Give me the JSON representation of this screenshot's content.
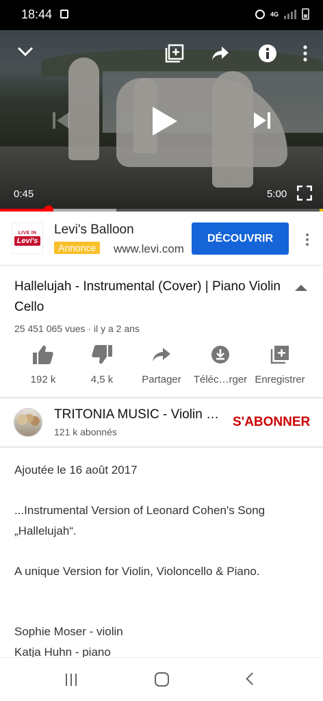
{
  "status_bar": {
    "time": "18:44",
    "network": "4G"
  },
  "player": {
    "current_time": "0:45",
    "duration": "5:00",
    "progress_fraction": 0.15,
    "buffered_fraction": 0.36
  },
  "ad": {
    "logo_line1": "LIVE IN",
    "logo_line2": "Levi's",
    "title": "Levi's Balloon",
    "badge": "Annonce",
    "url": "www.levi.com",
    "cta": "DÉCOUVRIR"
  },
  "video": {
    "title": "Hallelujah - Instrumental (Cover) | Piano Violin Cello",
    "meta": "25 451 065 vues · il y a 2 ans"
  },
  "actions": {
    "like": "192 k",
    "dislike": "4,5 k",
    "share": "Partager",
    "download": "Téléc…rger",
    "save": "Enregistrer"
  },
  "channel": {
    "name": "TRITONIA MUSIC - Violin Cello Piano",
    "subscribers": "121 k abonnés",
    "subscribe": "S'ABONNER"
  },
  "description": {
    "added": "Ajoutée le 16 août 2017",
    "line1": "...Instrumental Version of Leonard Cohen's Song",
    "line2": "„Hallelujah“.",
    "line3": "A unique Version for Violin, Violoncello & Piano.",
    "line4": "Sophie Moser - violin",
    "line5": "Katja Huhn - piano"
  },
  "colors": {
    "accent_red": "#ff0000",
    "cta_blue": "#1565d8",
    "badge_yellow": "#f9c02b",
    "subscribe_red": "#cc0000"
  }
}
